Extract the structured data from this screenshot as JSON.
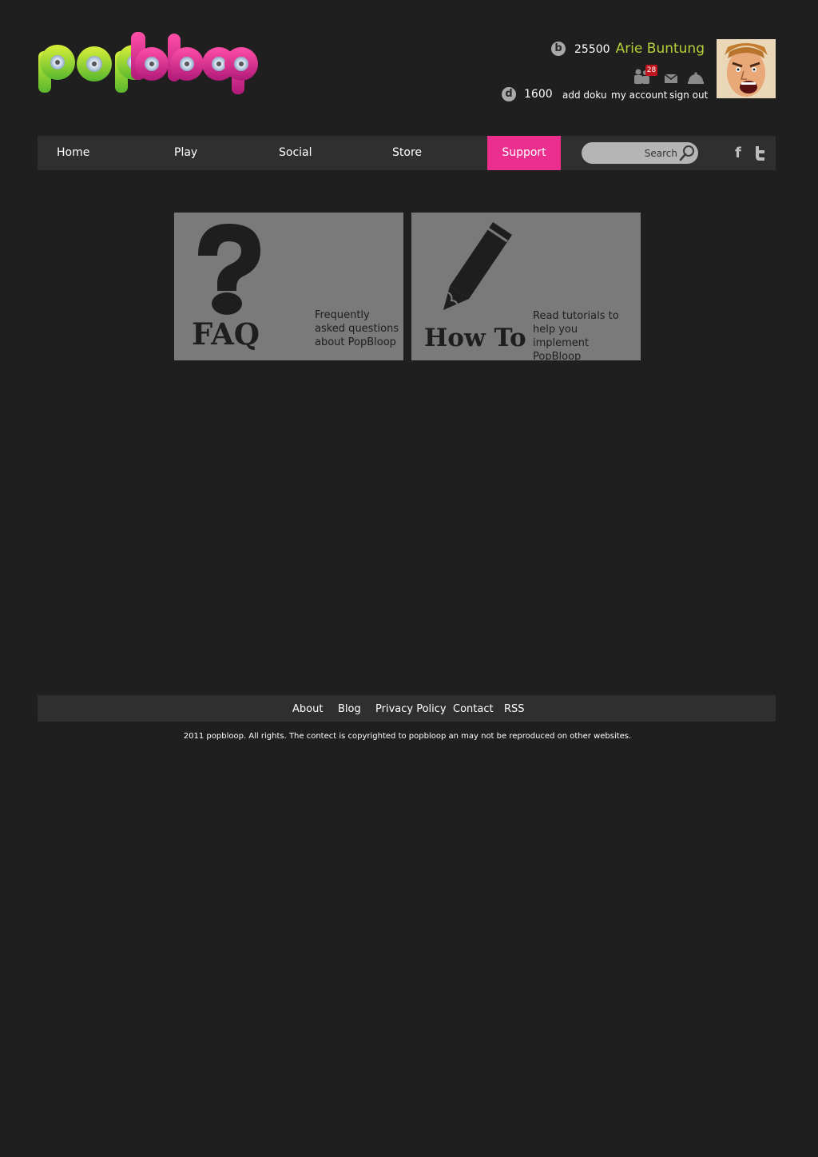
{
  "brand": {
    "logo_text": "popbloop"
  },
  "user": {
    "name": "Arie Buntung",
    "bloops_symbol": "b",
    "bloops": "25500",
    "doku_symbol": "d",
    "doku": "1600",
    "notification_count": "28",
    "links": {
      "add_doku": "add doku",
      "my_account": "my account",
      "sign_out": "sign out"
    }
  },
  "nav": {
    "items": [
      {
        "label": "Home"
      },
      {
        "label": "Play"
      },
      {
        "label": "Social"
      },
      {
        "label": "Store"
      },
      {
        "label": "Support",
        "active": true
      }
    ],
    "search_placeholder": "Search",
    "active_color": "#ec2f8f"
  },
  "cards": [
    {
      "title": "FAQ",
      "description": "Frequently asked questions about PopBloop",
      "icon": "question-mark-icon"
    },
    {
      "title": "How To",
      "description": "Read tutorials to help you implement PopBloop",
      "icon": "pencil-icon"
    }
  ],
  "footer": {
    "links": [
      "About",
      "Blog",
      "Privacy Policy",
      "Contact",
      "RSS"
    ],
    "copyright": "2011 popbloop. All rights. The contect is copyrighted to popbloop an may not be reproduced on other websites."
  },
  "colors": {
    "background": "#1f1f1f",
    "bar": "#2f2f2f",
    "user_name": "#b6cf3a",
    "card": "#7a7a7a",
    "badge": "#c0141e"
  }
}
